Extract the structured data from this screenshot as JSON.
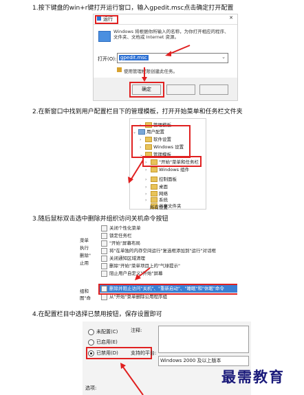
{
  "steps": [
    {
      "title": "1.按下键盘的win+r键打开运行窗口，输入gpedit.msc点击确定打开配置"
    },
    {
      "title": "2.在新窗口中找到用户配置栏目下的管理模板，打开开始菜单和任务栏文件夹"
    },
    {
      "title": "3.随后鼠标双击选中删除并组织访问关机命令按钮"
    },
    {
      "title": "4.在配置栏目中选择已禁用按钮，保存设置即可"
    }
  ],
  "run_dialog": {
    "title": "运行",
    "description": "Windows 将根据你所输入的名称，为你打开相应的程序、文件夹、文档或 Internet 资源。",
    "open_label": "打开(O):",
    "open_value": "gpedit.msc",
    "admin_note": "使用管理权限创建此任务。",
    "ok_label": "确定"
  },
  "tree": {
    "items": [
      {
        "label": "管理模板",
        "level": 1
      },
      {
        "label": "用户配置",
        "level": 0
      },
      {
        "label": "软件设置",
        "level": 1
      },
      {
        "label": "Windows 设置",
        "level": 1
      },
      {
        "label": "管理模板",
        "level": 1
      },
      {
        "label": "\"开始\"菜单和任务栏",
        "level": 2
      },
      {
        "label": "Windows 组件",
        "level": 2
      },
      {
        "label": "控制面板",
        "level": 2
      },
      {
        "label": "桌面",
        "level": 2
      },
      {
        "label": "网络",
        "level": 2
      },
      {
        "label": "系统",
        "level": 2
      },
      {
        "label": "共享文件夹",
        "level": 2
      },
      {
        "label": "所有设置",
        "level": 2
      }
    ]
  },
  "policies": {
    "side_labels": [
      "菜单",
      "执行",
      "删除\"",
      "止用",
      "组和",
      "图\"命"
    ],
    "items": [
      "关闭个性化菜单",
      "锁定任务栏",
      "\"开始\"屏幕布局",
      "将\"在单独的内存空间运行\"复选框添加到\"运行\"对话框",
      "关闭通知区域清理",
      "删除\"开始\"菜单项目上的\"气球提示\"",
      "阻止用户自定义\"开始\"屏幕",
      "删除并阻止访问\"关机\"、\"重新启动\"、\"睡眠\"和\"休眠\"命令",
      "从\"开始\"菜单删除公用程序组"
    ],
    "selected_index": 7
  },
  "config": {
    "options": [
      "未配置(C)",
      "已启用(E)",
      "已禁用(D)"
    ],
    "selected": 2,
    "comment_label": "注释:",
    "support_label": "支持的平台:",
    "support_value": "Windows 2000 及以上版本",
    "options_label": "选项:"
  },
  "watermark": "最需教育",
  "colors": {
    "accent_red": "#e02020",
    "selection_blue": "#3a7fd4",
    "window_blue": "#1f6fd2"
  }
}
